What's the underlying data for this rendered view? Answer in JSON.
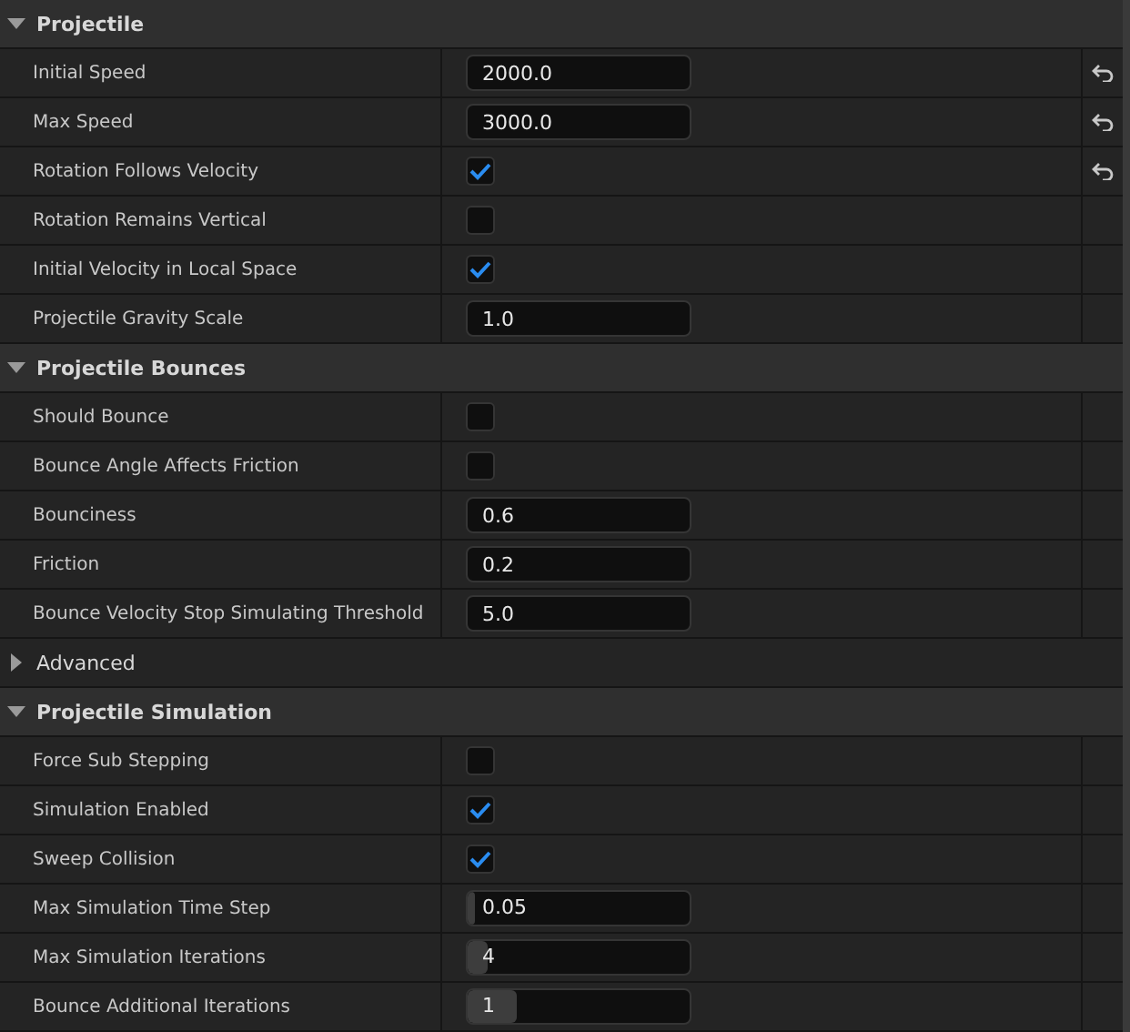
{
  "sections": [
    {
      "title": "Projectile",
      "expanded": true,
      "properties": [
        {
          "kind": "number",
          "label": "Initial Speed",
          "value": "2000.0",
          "resettable": true
        },
        {
          "kind": "number",
          "label": "Max Speed",
          "value": "3000.0",
          "resettable": true
        },
        {
          "kind": "checkbox",
          "label": "Rotation Follows Velocity",
          "checked": true,
          "resettable": true
        },
        {
          "kind": "checkbox",
          "label": "Rotation Remains Vertical",
          "checked": false,
          "resettable": false
        },
        {
          "kind": "checkbox",
          "label": "Initial Velocity in Local Space",
          "checked": true,
          "resettable": false
        },
        {
          "kind": "number",
          "label": "Projectile Gravity Scale",
          "value": "1.0",
          "resettable": false
        }
      ]
    },
    {
      "title": "Projectile Bounces",
      "expanded": true,
      "properties": [
        {
          "kind": "checkbox",
          "label": "Should Bounce",
          "checked": false,
          "resettable": false
        },
        {
          "kind": "checkbox",
          "label": "Bounce Angle Affects Friction",
          "checked": false,
          "resettable": false
        },
        {
          "kind": "number",
          "label": "Bounciness",
          "value": "0.6",
          "resettable": false
        },
        {
          "kind": "number",
          "label": "Friction",
          "value": "0.2",
          "resettable": false
        },
        {
          "kind": "number",
          "label": "Bounce Velocity Stop Simulating Threshold",
          "value": "5.0",
          "resettable": false
        }
      ]
    },
    {
      "title": "Advanced",
      "expanded": false
    },
    {
      "title": "Projectile Simulation",
      "expanded": true,
      "properties": [
        {
          "kind": "checkbox",
          "label": "Force Sub Stepping",
          "checked": false,
          "resettable": false
        },
        {
          "kind": "checkbox",
          "label": "Simulation Enabled",
          "checked": true,
          "resettable": false
        },
        {
          "kind": "checkbox",
          "label": "Sweep Collision",
          "checked": true,
          "resettable": false
        },
        {
          "kind": "slider",
          "label": "Max Simulation Time Step",
          "value": "0.05",
          "level": 0.02,
          "resettable": false
        },
        {
          "kind": "slider",
          "label": "Max Simulation Iterations",
          "value": "4",
          "level": 0.09,
          "resettable": false
        },
        {
          "kind": "slider",
          "label": "Bounce Additional Iterations",
          "value": "1",
          "level": 0.22,
          "resettable": false
        }
      ]
    }
  ]
}
